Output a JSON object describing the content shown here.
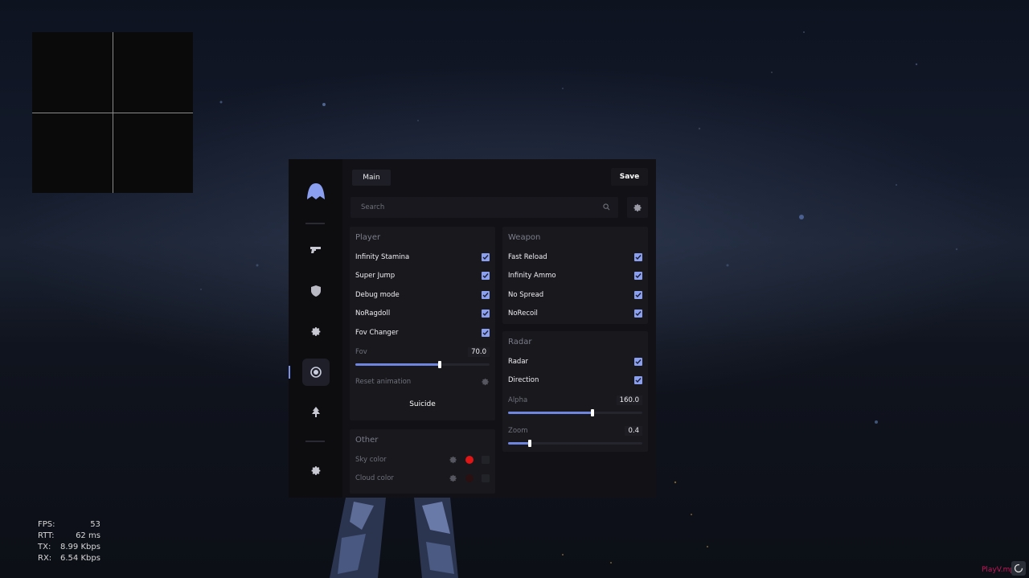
{
  "menu": {
    "tab_main": "Main",
    "save_label": "Save",
    "search_placeholder": "Search",
    "accent": "#8b9ff0",
    "sidebar": [
      "logo-icon",
      "gun-icon",
      "shield-icon",
      "gear-icon",
      "target-icon",
      "car-icon",
      "gear-icon"
    ],
    "player": {
      "title": "Player",
      "items": [
        {
          "label": "Infinity Stamina",
          "checked": true
        },
        {
          "label": "Super Jump",
          "checked": true
        },
        {
          "label": "Debug mode",
          "checked": true
        },
        {
          "label": "NoRagdoll",
          "checked": true
        },
        {
          "label": "Fov Changer",
          "checked": true
        }
      ],
      "fov_label": "Fov",
      "fov_value": "70.0",
      "fov_fraction": 0.63,
      "reset_label": "Reset animation",
      "suicide_label": "Suicide"
    },
    "weapon": {
      "title": "Weapon",
      "items": [
        {
          "label": "Fast Reload",
          "checked": true
        },
        {
          "label": "Infinity Ammo",
          "checked": true
        },
        {
          "label": "No Spread",
          "checked": true
        },
        {
          "label": "NoRecoil",
          "checked": true
        }
      ]
    },
    "radar": {
      "title": "Radar",
      "items": [
        {
          "label": "Radar",
          "checked": true
        },
        {
          "label": "Direction",
          "checked": true
        }
      ],
      "alpha_label": "Alpha",
      "alpha_value": "160.0",
      "alpha_fraction": 0.63,
      "zoom_label": "Zoom",
      "zoom_value": "0.4",
      "zoom_fraction": 0.16
    },
    "other": {
      "title": "Other",
      "sky_label": "Sky color",
      "sky_color": "#e01515",
      "cloud_label": "Cloud color",
      "cloud_color": "#2a1010"
    }
  },
  "stats": {
    "fps_key": "FPS:",
    "fps": "53",
    "rtt_key": "RTT:",
    "rtt": "62 ms",
    "tx_key": "TX:",
    "tx": "8.99 Kbps",
    "rx_key": "RX:",
    "rx": "6.54 Kbps"
  },
  "watermark": "PlayV.mp"
}
